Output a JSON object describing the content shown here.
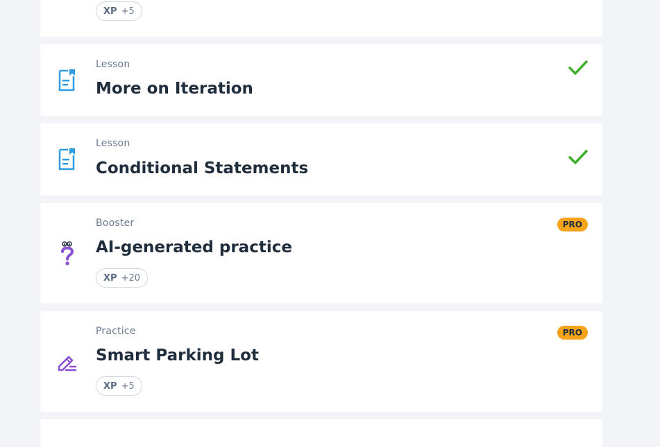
{
  "items": [
    {
      "xp": {
        "label": "XP",
        "value": "+5"
      }
    },
    {
      "type": "Lesson",
      "title": "More on Iteration",
      "status": "completed",
      "icon": "lesson-icon"
    },
    {
      "type": "Lesson",
      "title": "Conditional Statements",
      "status": "completed",
      "icon": "lesson-icon"
    },
    {
      "type": "Booster",
      "title": "AI-generated practice",
      "badge": "PRO",
      "icon": "question-mark-icon",
      "xp": {
        "label": "XP",
        "value": "+20"
      }
    },
    {
      "type": "Practice",
      "title": "Smart Parking Lot",
      "badge": "PRO",
      "icon": "pencil-icon",
      "xp": {
        "label": "XP",
        "value": "+5"
      }
    }
  ],
  "colors": {
    "background": "#f2f4f7",
    "check": "#3fae2a",
    "pro_badge": "#f7a31a",
    "lesson_icon": "#2f9be0",
    "practice_icon": "#8a4fd6"
  }
}
